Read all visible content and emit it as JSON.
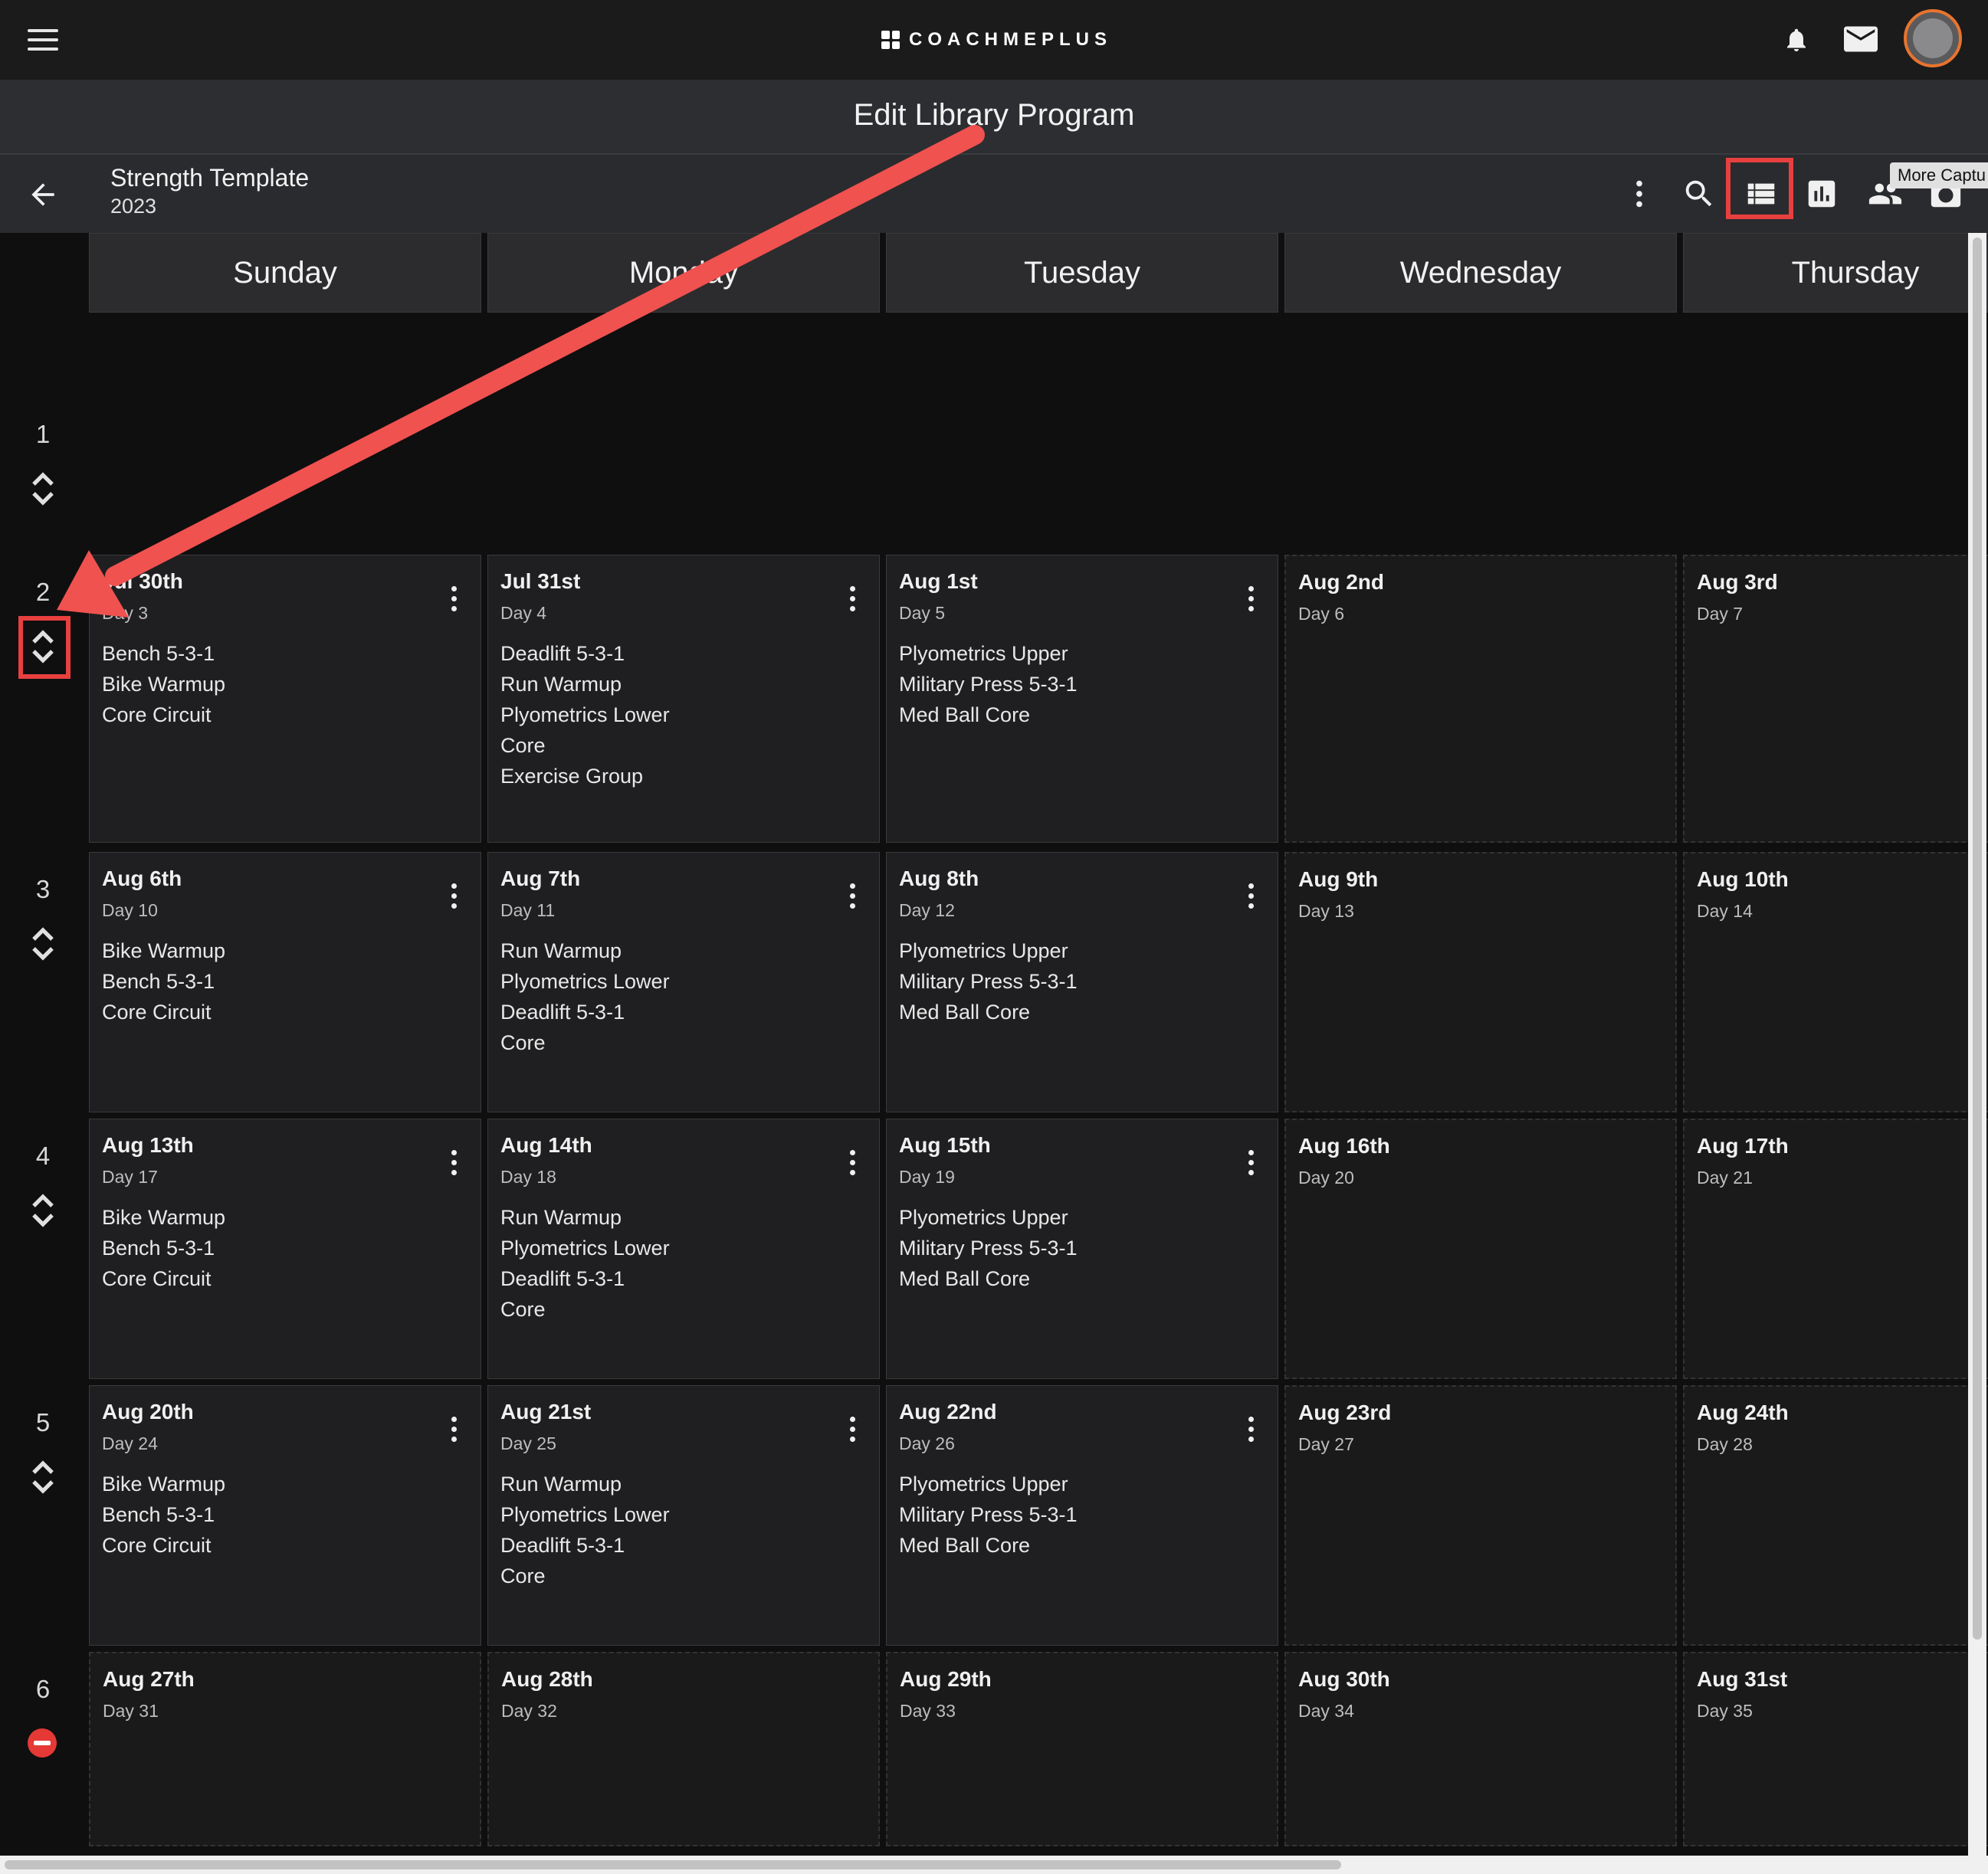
{
  "header": {
    "logo_text": "COACHMEPLUS",
    "icons": [
      "menu-icon",
      "bell-icon",
      "mail-icon",
      "avatar"
    ]
  },
  "titlebar": {
    "title": "Edit Library Program"
  },
  "program": {
    "name": "Strength Template",
    "year": "2023"
  },
  "toolbar": {
    "icons": [
      "more-vert-icon",
      "search-icon",
      "list-view-icon",
      "bar-chart-icon",
      "people-icon",
      "camera-icon"
    ],
    "tooltip": "More Captu"
  },
  "days": [
    "Sunday",
    "Monday",
    "Tuesday",
    "Wednesday",
    "Thursday"
  ],
  "weeks": [
    {
      "number": "1",
      "cells": []
    },
    {
      "number": "2",
      "cells": [
        {
          "date": "Jul 30th",
          "day": "Day 3",
          "items": [
            "Bench 5-3-1",
            "Bike Warmup",
            "Core Circuit"
          ]
        },
        {
          "date": "Jul 31st",
          "day": "Day 4",
          "items": [
            "Deadlift 5-3-1",
            "Run Warmup",
            "Plyometrics Lower",
            "Core",
            "Exercise Group"
          ]
        },
        {
          "date": "Aug 1st",
          "day": "Day 5",
          "items": [
            "Plyometrics Upper",
            "Military Press 5-3-1",
            "Med Ball Core"
          ]
        },
        {
          "date": "Aug 2nd",
          "day": "Day 6",
          "items": []
        },
        {
          "date": "Aug 3rd",
          "day": "Day 7",
          "items": []
        }
      ]
    },
    {
      "number": "3",
      "cells": [
        {
          "date": "Aug 6th",
          "day": "Day 10",
          "items": [
            "Bike Warmup",
            "Bench 5-3-1",
            "Core Circuit"
          ]
        },
        {
          "date": "Aug 7th",
          "day": "Day 11",
          "items": [
            "Run Warmup",
            "Plyometrics Lower",
            "Deadlift 5-3-1",
            "Core"
          ]
        },
        {
          "date": "Aug 8th",
          "day": "Day 12",
          "items": [
            "Plyometrics Upper",
            "Military Press 5-3-1",
            "Med Ball Core"
          ]
        },
        {
          "date": "Aug 9th",
          "day": "Day 13",
          "items": []
        },
        {
          "date": "Aug 10th",
          "day": "Day 14",
          "items": []
        }
      ]
    },
    {
      "number": "4",
      "cells": [
        {
          "date": "Aug 13th",
          "day": "Day 17",
          "items": [
            "Bike Warmup",
            "Bench 5-3-1",
            "Core Circuit"
          ]
        },
        {
          "date": "Aug 14th",
          "day": "Day 18",
          "items": [
            "Run Warmup",
            "Plyometrics Lower",
            "Deadlift 5-3-1",
            "Core"
          ]
        },
        {
          "date": "Aug 15th",
          "day": "Day 19",
          "items": [
            "Plyometrics Upper",
            "Military Press 5-3-1",
            "Med Ball Core"
          ]
        },
        {
          "date": "Aug 16th",
          "day": "Day 20",
          "items": []
        },
        {
          "date": "Aug 17th",
          "day": "Day 21",
          "items": []
        }
      ]
    },
    {
      "number": "5",
      "cells": [
        {
          "date": "Aug 20th",
          "day": "Day 24",
          "items": [
            "Bike Warmup",
            "Bench 5-3-1",
            "Core Circuit"
          ]
        },
        {
          "date": "Aug 21st",
          "day": "Day 25",
          "items": [
            "Run Warmup",
            "Plyometrics Lower",
            "Deadlift 5-3-1",
            "Core"
          ]
        },
        {
          "date": "Aug 22nd",
          "day": "Day 26",
          "items": [
            "Plyometrics Upper",
            "Military Press 5-3-1",
            "Med Ball Core"
          ]
        },
        {
          "date": "Aug 23rd",
          "day": "Day 27",
          "items": []
        },
        {
          "date": "Aug 24th",
          "day": "Day 28",
          "items": []
        }
      ]
    },
    {
      "number": "6",
      "cells": [
        {
          "date": "Aug 27th",
          "day": "Day 31",
          "items": []
        },
        {
          "date": "Aug 28th",
          "day": "Day 32",
          "items": []
        },
        {
          "date": "Aug 29th",
          "day": "Day 33",
          "items": []
        },
        {
          "date": "Aug 30th",
          "day": "Day 34",
          "items": []
        },
        {
          "date": "Aug 31st",
          "day": "Day 35",
          "items": []
        }
      ]
    }
  ],
  "colors": {
    "accent": "#e8403f",
    "avatar_ring": "#e8742e",
    "remove": "#e53935"
  }
}
